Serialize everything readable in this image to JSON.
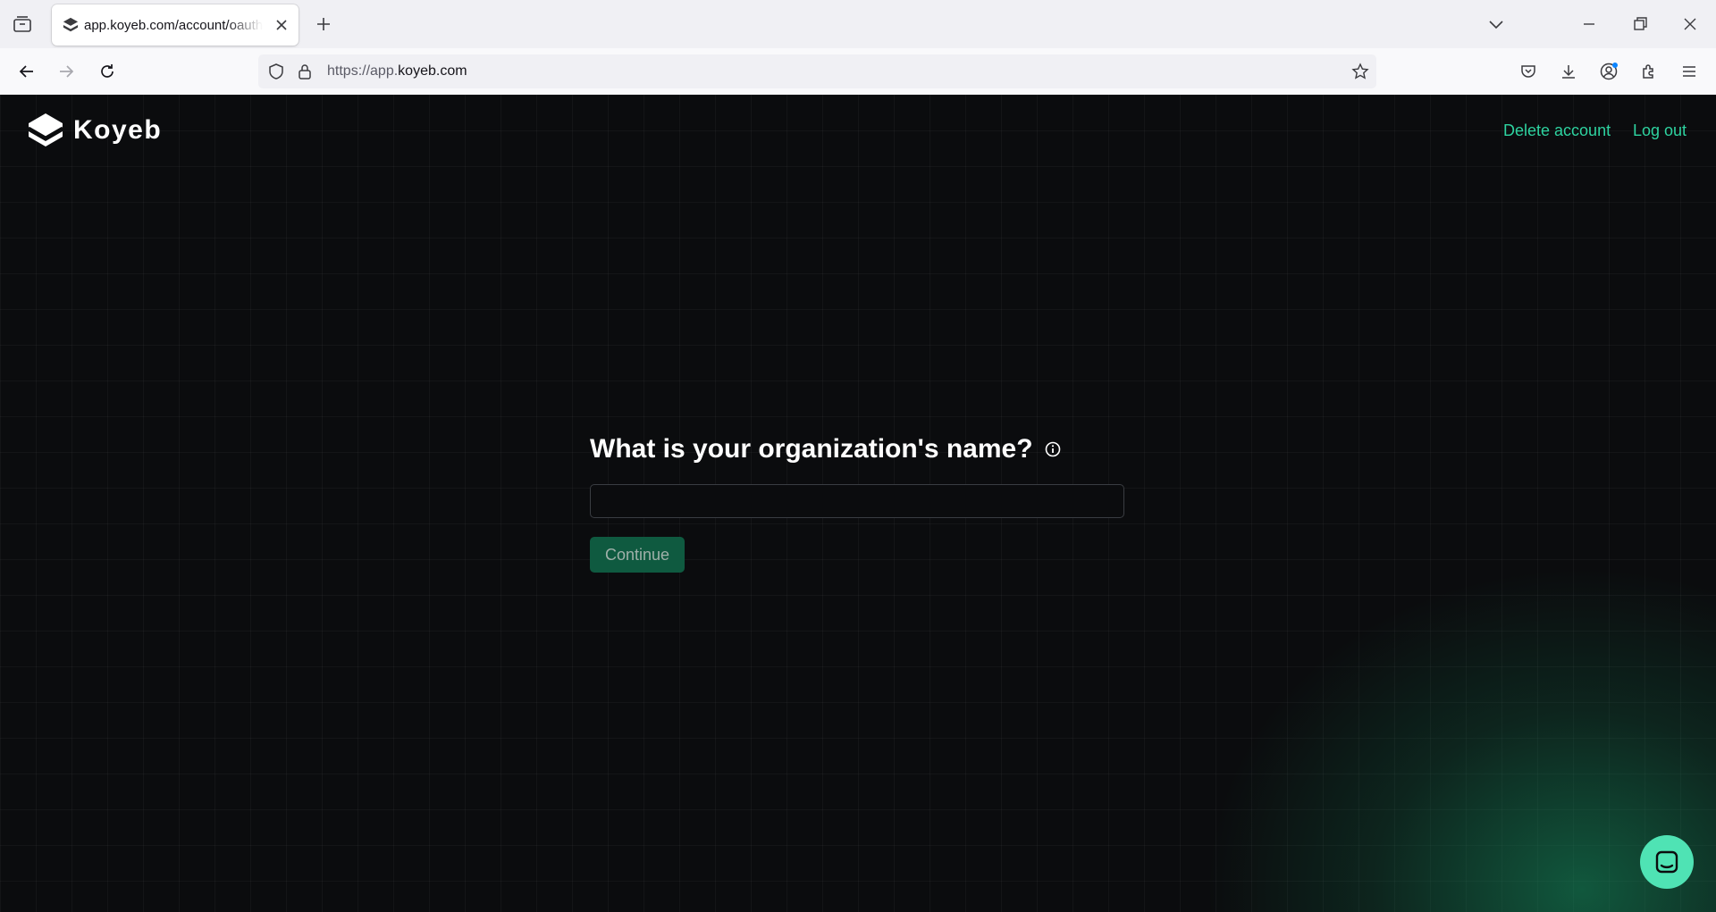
{
  "browser": {
    "tab_title": "app.koyeb.com/account/oauth/",
    "url_scheme": "https://app.",
    "url_host": "koyeb.com"
  },
  "header": {
    "logo_text": "Koyeb",
    "delete_account_label": "Delete account",
    "logout_label": "Log out"
  },
  "form": {
    "question": "What is your organization's name?",
    "input_value": "",
    "input_placeholder": "",
    "continue_label": "Continue"
  },
  "colors": {
    "accent": "#2ed3a0",
    "button_bg": "#0f5a40",
    "page_bg": "#0b0c0e"
  },
  "icons": [
    "tab-overview-icon",
    "koyeb-favicon-icon",
    "close-icon",
    "plus-icon",
    "chevron-down-icon",
    "minimize-icon",
    "restore-icon",
    "window-close-icon",
    "back-arrow-icon",
    "forward-arrow-icon",
    "reload-icon",
    "shield-icon",
    "lock-icon",
    "star-icon",
    "pocket-icon",
    "download-icon",
    "account-icon",
    "extensions-icon",
    "menu-icon",
    "info-icon",
    "chat-icon"
  ]
}
